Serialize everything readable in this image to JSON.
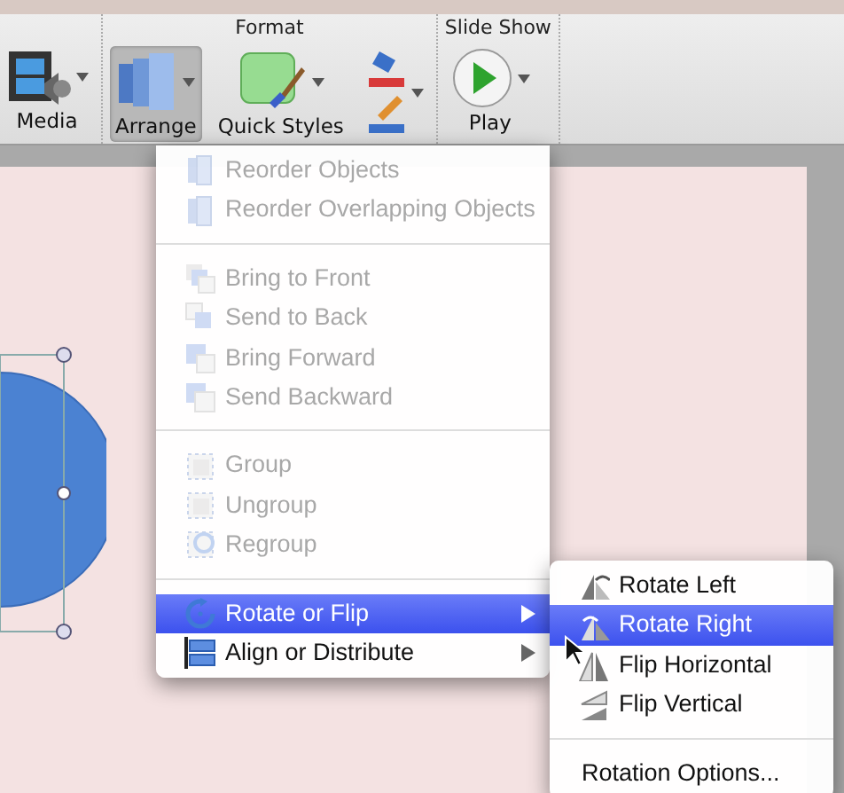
{
  "ribbon": {
    "groups": [
      {
        "buttons": [
          {
            "label": "Media",
            "kind": "media",
            "selected": false,
            "dropdown": true
          }
        ]
      },
      {
        "title": "Format",
        "buttons": [
          {
            "label": "Arrange",
            "kind": "arrange",
            "selected": true,
            "dropdown": true
          },
          {
            "label": "Quick Styles",
            "kind": "styles",
            "selected": false,
            "dropdown": true
          },
          {
            "kind": "colors",
            "selected": false,
            "dropdown": true
          }
        ]
      },
      {
        "title": "Slide Show",
        "buttons": [
          {
            "label": "Play",
            "kind": "play",
            "selected": false,
            "dropdown": true
          }
        ]
      }
    ]
  },
  "menu": {
    "sections": [
      [
        {
          "label": "Reorder Objects",
          "kind": "reorder",
          "disabled": true,
          "selected": false,
          "submenu": false
        },
        {
          "label": "Reorder Overlapping Objects",
          "kind": "reorder",
          "disabled": true,
          "selected": false,
          "submenu": false
        }
      ],
      [
        {
          "label": "Bring to Front",
          "kind": "front",
          "disabled": true,
          "selected": false,
          "submenu": false
        },
        {
          "label": "Send to Back",
          "kind": "back",
          "disabled": true,
          "selected": false,
          "submenu": false
        },
        {
          "label": "Bring Forward",
          "kind": "forward",
          "disabled": true,
          "selected": false,
          "submenu": false
        },
        {
          "label": "Send Backward",
          "kind": "backward",
          "disabled": true,
          "selected": false,
          "submenu": false
        }
      ],
      [
        {
          "label": "Group",
          "kind": "group",
          "disabled": true,
          "selected": false,
          "submenu": false
        },
        {
          "label": "Ungroup",
          "kind": "group",
          "disabled": true,
          "selected": false,
          "submenu": false
        },
        {
          "label": "Regroup",
          "kind": "regroup",
          "disabled": true,
          "selected": false,
          "submenu": false
        }
      ],
      [
        {
          "label": "Rotate or Flip",
          "kind": "rotate",
          "disabled": false,
          "selected": true,
          "submenu": true
        },
        {
          "label": "Align or Distribute",
          "kind": "align",
          "disabled": false,
          "selected": false,
          "submenu": true
        }
      ]
    ]
  },
  "submenu": {
    "sections": [
      [
        {
          "label": "Rotate Left",
          "kind": "rotleft",
          "selected": false
        },
        {
          "label": "Rotate Right",
          "kind": "rotright",
          "selected": true
        },
        {
          "label": "Flip Horizontal",
          "kind": "fliph",
          "selected": false
        },
        {
          "label": "Flip Vertical",
          "kind": "flipv",
          "selected": false
        }
      ],
      [
        {
          "label": "Rotation Options...",
          "selected": false
        }
      ]
    ]
  }
}
